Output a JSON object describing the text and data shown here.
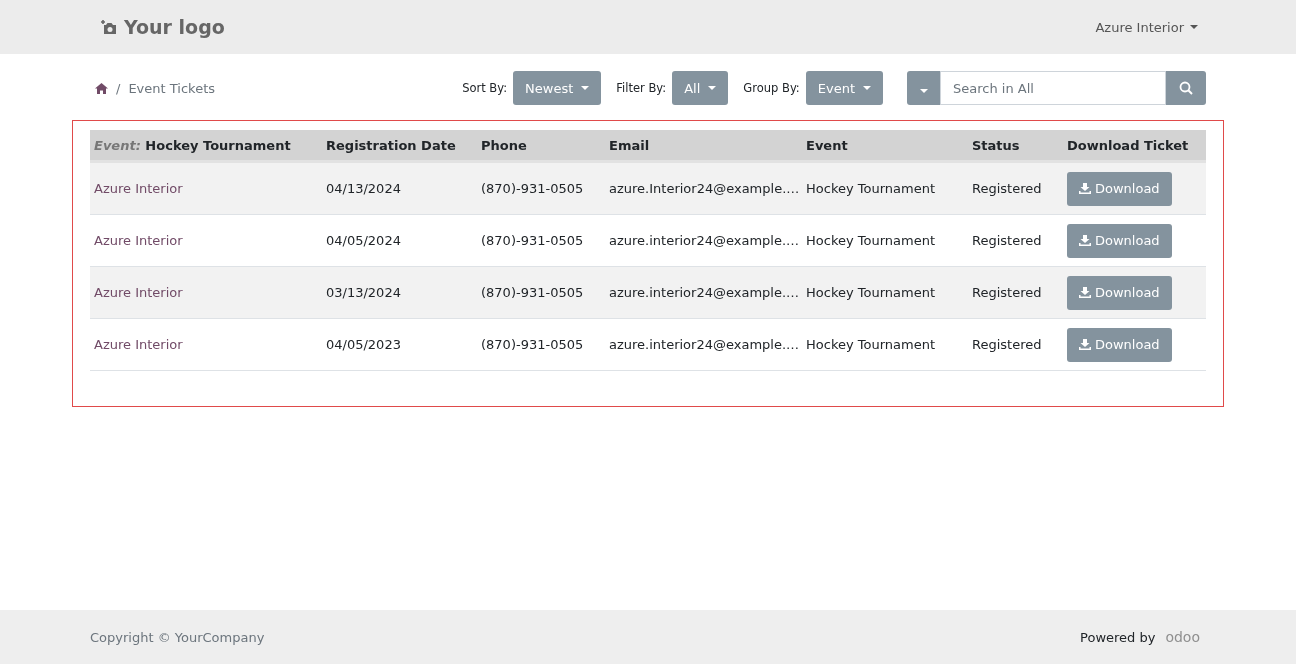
{
  "header": {
    "logo": "Your logo",
    "user_menu": "Azure Interior"
  },
  "breadcrumb": {
    "separator": "/",
    "current": "Event Tickets"
  },
  "controls": [
    {
      "label": "Sort By:",
      "value": "Newest"
    },
    {
      "label": "Filter By:",
      "value": "All"
    },
    {
      "label": "Group By:",
      "value": "Event"
    }
  ],
  "search": {
    "placeholder": "Search in All"
  },
  "table": {
    "group_label": "Event:",
    "group_value": "Hockey Tournament",
    "columns": [
      "Registration Date",
      "Phone",
      "Email",
      "Event",
      "Status",
      "Download Ticket"
    ],
    "rows": [
      {
        "name": "Azure Interior",
        "date": "04/13/2024",
        "phone": "(870)-931-0505",
        "email": "azure.Interior24@example.…",
        "event": "Hockey Tournament",
        "status": "Registered",
        "action": "Download"
      },
      {
        "name": "Azure Interior",
        "date": "04/05/2024",
        "phone": "(870)-931-0505",
        "email": "azure.interior24@example.…",
        "event": "Hockey Tournament",
        "status": "Registered",
        "action": "Download"
      },
      {
        "name": "Azure Interior",
        "date": "03/13/2024",
        "phone": "(870)-931-0505",
        "email": "azure.interior24@example.…",
        "event": "Hockey Tournament",
        "status": "Registered",
        "action": "Download"
      },
      {
        "name": "Azure Interior",
        "date": "04/05/2023",
        "phone": "(870)-931-0505",
        "email": "azure.interior24@example.…",
        "event": "Hockey Tournament",
        "status": "Registered",
        "action": "Download"
      }
    ]
  },
  "footer": {
    "copyright": "Copyright © YourCompany",
    "powered_by": "Powered by",
    "brand": "odoo"
  }
}
